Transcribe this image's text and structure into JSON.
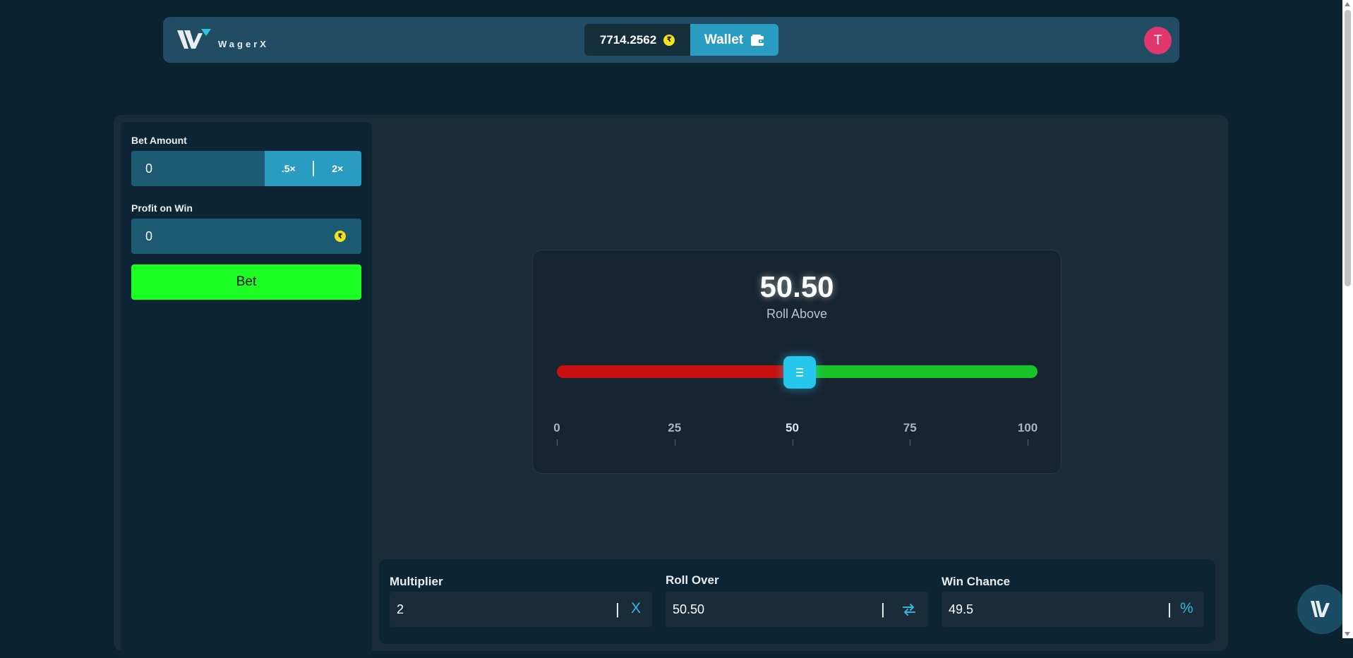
{
  "header": {
    "brand_name": "WagerX",
    "logo_text": "WagerX",
    "balance": "7714.2562",
    "currency_icon": "rupee-coin-icon",
    "currency_symbol": "₹",
    "wallet_label": "Wallet",
    "wallet_icon": "wallet-icon",
    "avatar_initial": "T"
  },
  "sidebar": {
    "bet_amount_label": "Bet Amount",
    "bet_amount_value": "0",
    "half_label": ".5×",
    "double_label": "2×",
    "profit_label": "Profit on Win",
    "profit_value": "0",
    "bet_button_label": "Bet"
  },
  "dice": {
    "roll_value": "50.50",
    "roll_mode": "Roll Above",
    "slider_value": 50.5,
    "lose_color": "#c81010",
    "win_color": "#19c329",
    "scale_ticks": [
      "0",
      "25",
      "50",
      "75",
      "100"
    ]
  },
  "params": {
    "multiplier_label": "Multiplier",
    "multiplier_value": "2",
    "multiplier_suffix": "X",
    "roll_over_label": "Roll Over",
    "roll_over_value": "50.50",
    "roll_over_icon": "swap-arrows-icon",
    "win_chance_label": "Win Chance",
    "win_chance_value": "49.5",
    "win_chance_suffix": "%"
  },
  "colors": {
    "accent": "#2a9cc1",
    "bet_button": "#1dfe22",
    "avatar": "#e0386e",
    "coin": "#f4e21b"
  }
}
